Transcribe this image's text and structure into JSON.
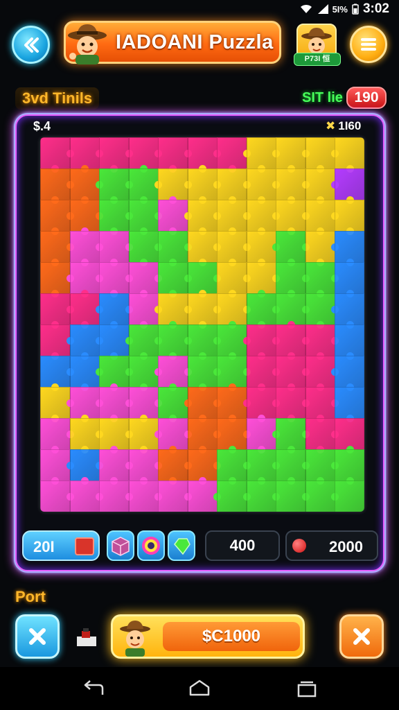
{
  "status_bar": {
    "battery": "5I%",
    "time": "3:02",
    "icons": [
      "wifi-icon",
      "signal-icon",
      "battery-icon"
    ]
  },
  "header": {
    "title": "IADOANI Puzzla",
    "profile_tag": "P73I 恒",
    "back_icon": "double-chevron-left-icon",
    "menu_icon": "hamburger-icon"
  },
  "info_row": {
    "level_label": "3vd Tinils",
    "time_label": "SIT lie",
    "time_value": "190"
  },
  "board": {
    "top_left": "$.4",
    "top_right": "1I60",
    "colors": {
      "frame": "#e65dff",
      "glow": "#6ae7ff",
      "pieces": [
        "#ff2e8a",
        "#ff6a1a",
        "#ffd81f",
        "#4ae83a",
        "#2a8cff",
        "#b43cff",
        "#ff4fd8",
        "#20c9b8"
      ]
    }
  },
  "tools": {
    "coins": "20I",
    "stat_one": "400",
    "stat_two": "2000",
    "tool_icons": [
      "chest-icon",
      "crate-icon",
      "ring-icon",
      "gem-icon"
    ]
  },
  "footer": {
    "port_label": "Port",
    "buy_value": "$C1000",
    "cancel_icon": "x-icon",
    "close_icon": "x-icon"
  }
}
